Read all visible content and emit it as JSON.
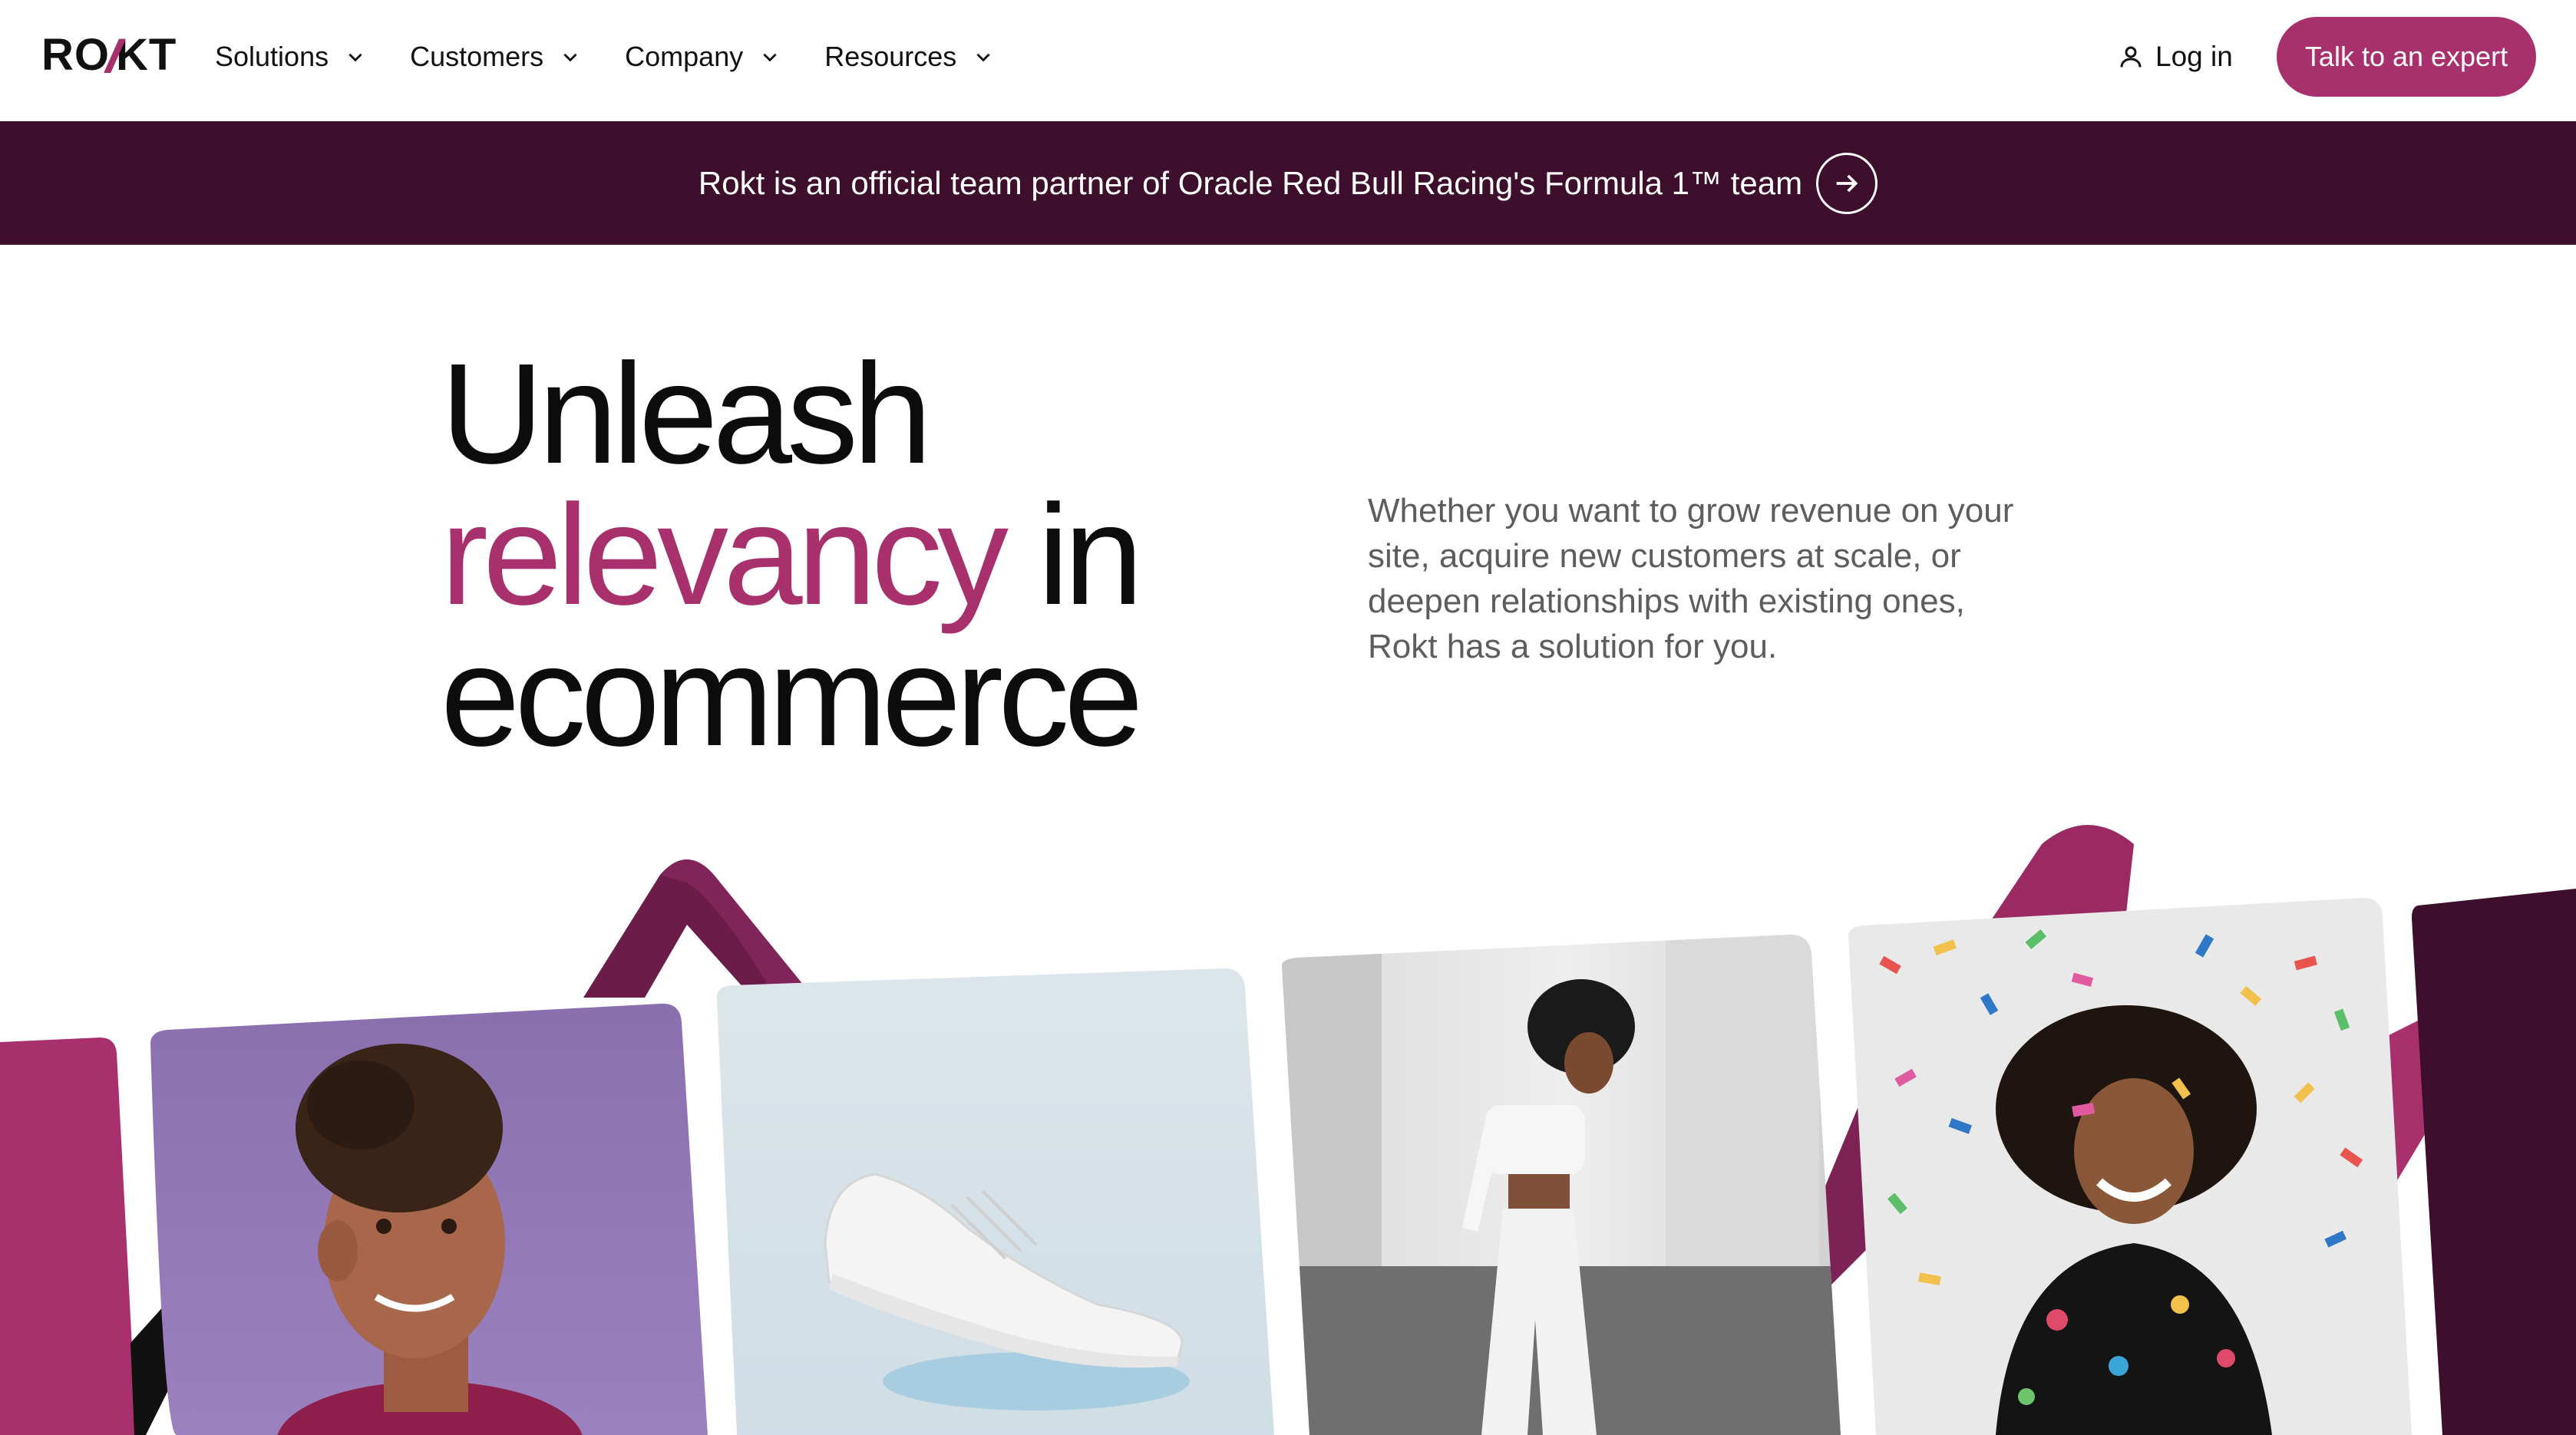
{
  "brand": {
    "logo_text": "ROKT",
    "accent": "#a8316d",
    "dark": "#3d0f2c"
  },
  "nav": {
    "menu": [
      {
        "label": "Solutions",
        "icon": "chevron-down-icon"
      },
      {
        "label": "Customers",
        "icon": "chevron-down-icon"
      },
      {
        "label": "Company",
        "icon": "chevron-down-icon"
      },
      {
        "label": "Resources",
        "icon": "chevron-down-icon"
      }
    ],
    "login_label": "Log in",
    "login_icon": "user-icon",
    "cta_label": "Talk to an expert"
  },
  "banner": {
    "text": "Rokt is an official team partner of Oracle Red Bull Racing's Formula 1™ team",
    "icon": "arrow-right-circle-icon"
  },
  "hero": {
    "headline_line1": "Unleash",
    "headline_accent": "relevancy",
    "headline_line2_rest": " in",
    "headline_line3": "ecommerce",
    "subtext": "Whether you want to grow revenue on your site, acquire new customers at scale, or deepen relationships with existing ones, Rokt has a solution for you."
  },
  "gallery": {
    "cards": [
      {
        "name": "smiling-woman-photo"
      },
      {
        "name": "white-sneaker-photo"
      },
      {
        "name": "woman-walking-street-photo"
      },
      {
        "name": "woman-confetti-photo"
      }
    ]
  }
}
